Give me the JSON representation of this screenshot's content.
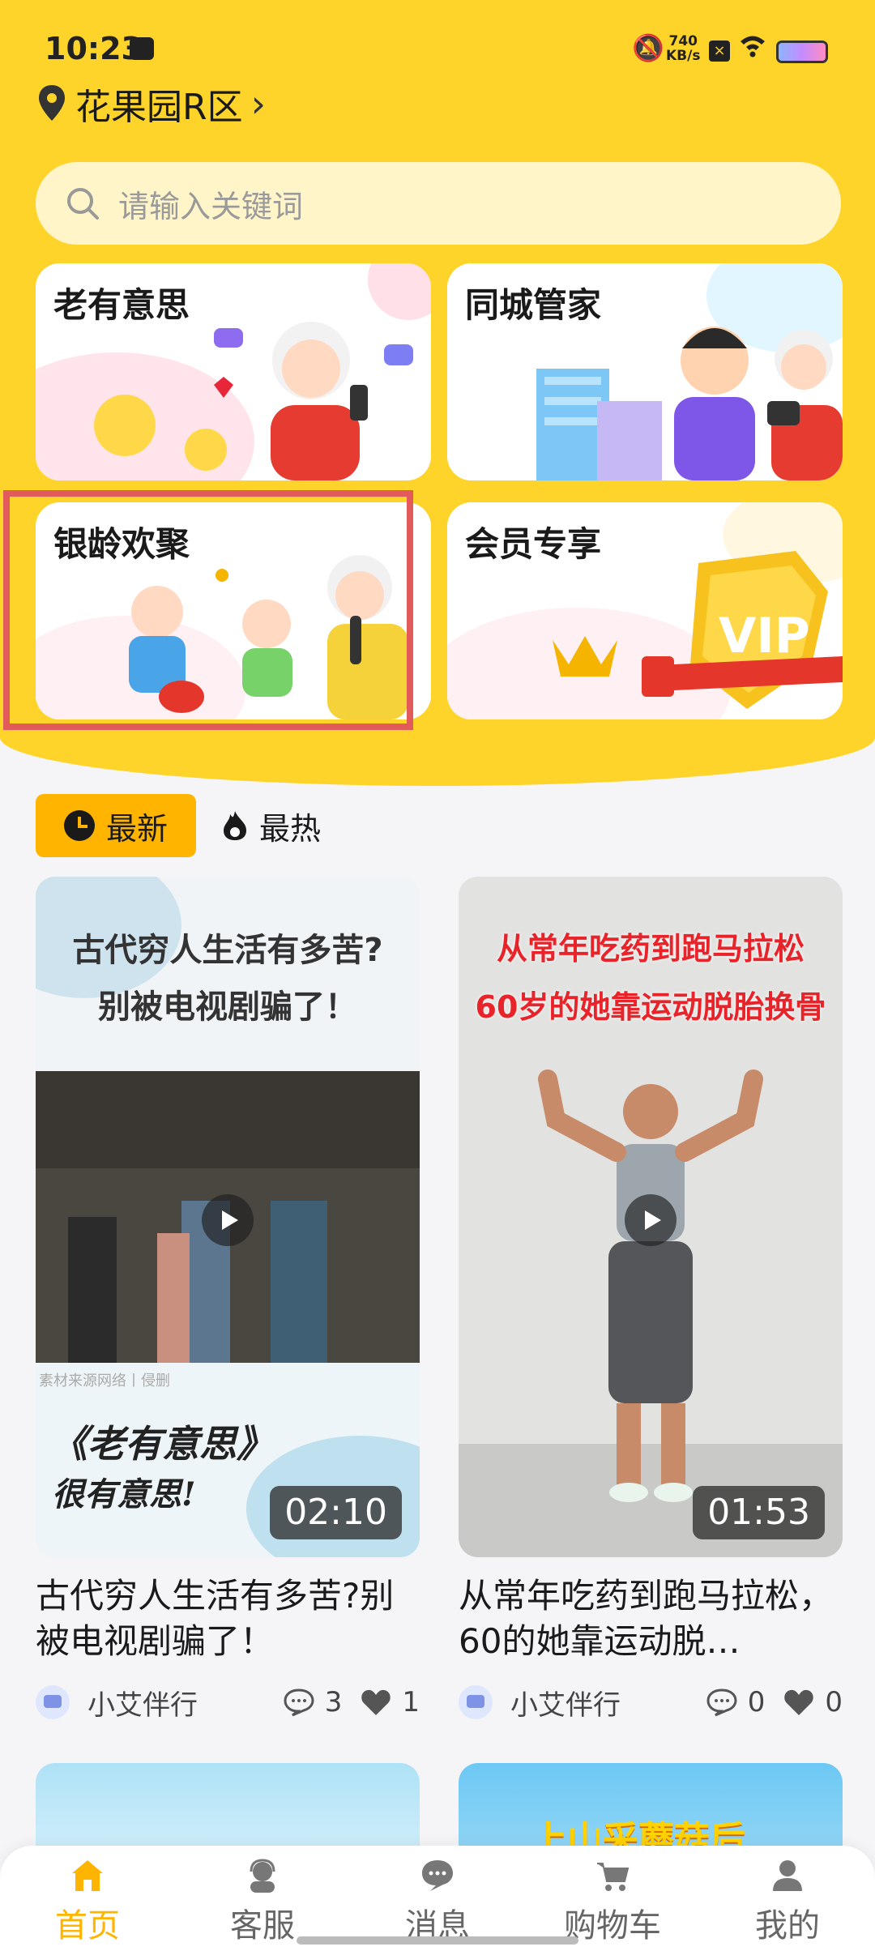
{
  "status": {
    "time": "10:23",
    "speed_value": "740",
    "speed_unit": "KB/s"
  },
  "location": {
    "name": "花果园R区"
  },
  "search": {
    "placeholder": "请输入关键词"
  },
  "categories": [
    {
      "label": "老有意思"
    },
    {
      "label": "同城管家"
    },
    {
      "label": "银龄欢聚"
    },
    {
      "label": "会员专享"
    }
  ],
  "feed_tabs": {
    "newest": "最新",
    "hottest": "最热"
  },
  "videos": [
    {
      "overlay_lines": [
        "古代穷人生活有多苦?",
        "别被电视剧骗了！",
        "《老有意思》",
        "很有意思!"
      ],
      "source_note": "素材来源网络丨侵删",
      "duration": "02:10",
      "title": "古代穷人生活有多苦?别被电视剧骗了！",
      "author": "小艾伴行",
      "comments": "3",
      "likes": "1"
    },
    {
      "overlay_lines": [
        "从常年吃药到跑马拉松",
        "60岁的她靠运动脱胎换骨"
      ],
      "duration": "01:53",
      "title": "从常年吃药到跑马拉松，60的她靠运动脱…",
      "author": "小艾伴行",
      "comments": "0",
      "likes": "0"
    }
  ],
  "peek_cards": [
    {
      "text": ""
    },
    {
      "text": "上山采蘑菇后"
    }
  ],
  "nav": [
    {
      "label": "首页",
      "icon": "home-icon",
      "active": true
    },
    {
      "label": "客服",
      "icon": "customer-service-icon"
    },
    {
      "label": "消息",
      "icon": "message-icon"
    },
    {
      "label": "购物车",
      "icon": "cart-icon"
    },
    {
      "label": "我的",
      "icon": "profile-icon"
    }
  ],
  "colors": {
    "brand_yellow": "#ffd42a",
    "accent_orange": "#ffb400",
    "highlight_red": "#e35a5a"
  }
}
